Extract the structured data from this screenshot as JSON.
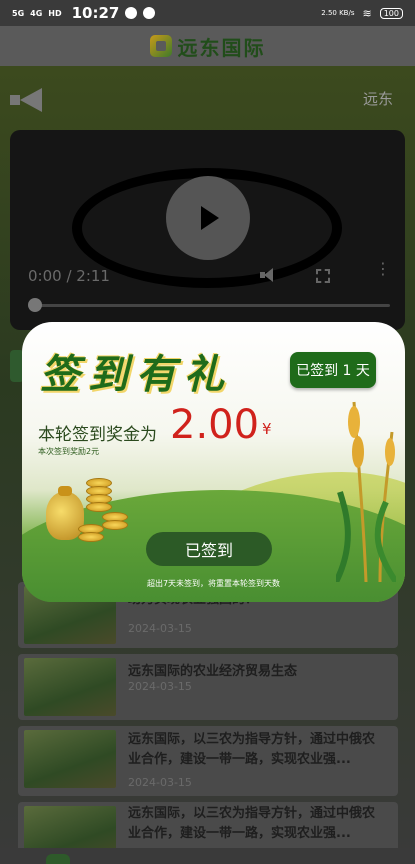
{
  "status_bar": {
    "signal_1": "5G",
    "signal_2": "4G",
    "hd": "HD",
    "time": "10:27",
    "speed": "2.50\nKB/s",
    "battery": "100"
  },
  "header": {
    "title": "远东国际"
  },
  "notice": {
    "marquee": "远东"
  },
  "video": {
    "time": "0:00 / 2:11",
    "progress": 0.0
  },
  "popup": {
    "heading": "签到有礼",
    "badge": "已签到 1 天",
    "amount_label": "本轮签到奖金为",
    "amount": "2.00",
    "currency": "¥",
    "sub_note": "本次签到奖励2元",
    "button": "已签到",
    "footer_note": "超出7天未签到，将重置本轮签到天数"
  },
  "articles": [
    {
      "title": "助力实现农业强国的？",
      "date": "2024-03-15"
    },
    {
      "title": "远东国际的农业经济贸易生态",
      "date": "2024-03-15"
    },
    {
      "title": "远东国际，以三农为指导方针，通过中俄农业合作，建设一带一路，实现农业强...",
      "date": "2024-03-15"
    },
    {
      "title": "远东国际，以三农为指导方针，通过中俄农业合作，建设一带一路，实现农业强...",
      "date": ""
    }
  ],
  "colors": {
    "brand_green": "#1f6b1a",
    "amount_red": "#d0221c"
  }
}
